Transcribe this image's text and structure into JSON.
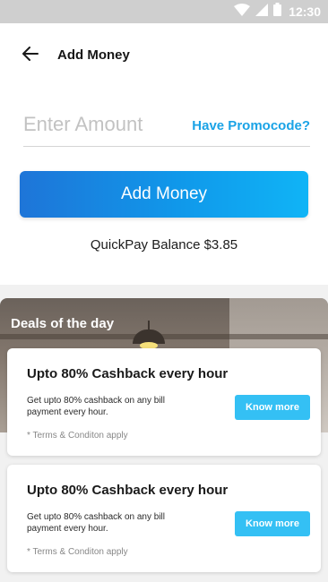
{
  "status_bar": {
    "time": "12:30",
    "icons": [
      "wifi-icon",
      "signal-icon",
      "battery-icon"
    ]
  },
  "header": {
    "title": "Add Money",
    "back_icon": "back-arrow-icon"
  },
  "amount": {
    "placeholder": "Enter Amount",
    "value": "",
    "promo_label": "Have Promocode?"
  },
  "add_button": {
    "label": "Add Money"
  },
  "balance": {
    "text": "QuickPay Balance $3.85"
  },
  "deals": {
    "title": "Deals of the day",
    "cards": [
      {
        "title": "Upto 80% Cashback every hour",
        "description": "Get upto 80% cashback on any bill payment every hour.",
        "terms": "* Terms & Conditon apply",
        "button_label": "Know more"
      },
      {
        "title": "Upto 80% Cashback every hour",
        "description": "Get upto 80% cashback on any bill payment every hour.",
        "terms": "* Terms & Conditon apply",
        "button_label": "Know more"
      }
    ]
  },
  "colors": {
    "accent": "#1aa3e6",
    "button_gradient_start": "#1e75d8",
    "button_gradient_end": "#10b4f6",
    "know_more": "#34c0f4",
    "status_bar": "#cfcfcf"
  }
}
